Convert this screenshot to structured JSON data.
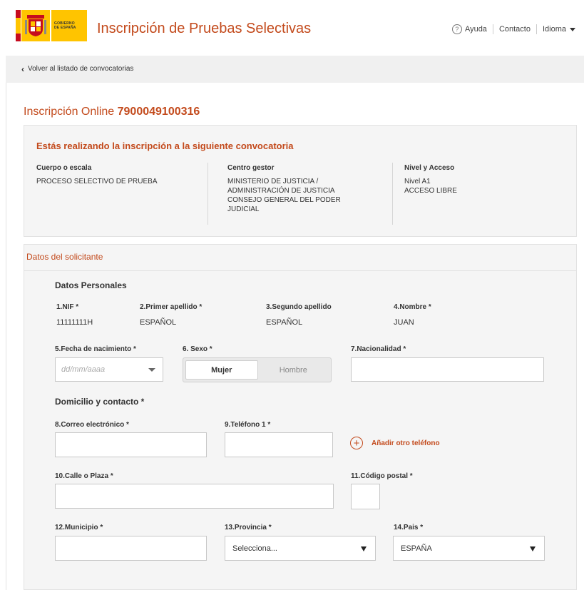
{
  "header": {
    "gov_line1": "GOBIERNO",
    "gov_line2": "DE ESPAÑA",
    "title": "Inscripción de Pruebas Selectivas",
    "help_label": "Ayuda",
    "contact_label": "Contacto",
    "language_label": "Idioma"
  },
  "breadcrumb": {
    "back_label": "Volver al listado de convocatorias"
  },
  "page": {
    "title_prefix": "Inscripción Online",
    "registration_number": "7900049100316"
  },
  "convocatoria": {
    "heading": "Estás realizando la inscripción a la siguiente convocatoria",
    "cuerpo_label": "Cuerpo o escala",
    "cuerpo_value": "PROCESO SELECTIVO DE PRUEBA",
    "centro_label": "Centro gestor",
    "centro_lines": [
      "MINISTERIO DE JUSTICIA /",
      "ADMINISTRACIÓN DE JUSTICIA",
      "CONSEJO GENERAL DEL PODER",
      "JUDICIAL"
    ],
    "nivel_label": "Nivel y Acceso",
    "nivel_lines": [
      "Nivel A1",
      "ACCESO LIBRE"
    ]
  },
  "solicitante": {
    "title": "Datos del solicitante",
    "personal_section": "Datos Personales",
    "nif_label": "1.NIF *",
    "nif_value": "11111111H",
    "apellido1_label": "2.Primer apellido *",
    "apellido1_value": "ESPAÑOL",
    "apellido2_label": "3.Segundo apellido",
    "apellido2_value": "ESPAÑOL",
    "nombre_label": "4.Nombre *",
    "nombre_value": "JUAN",
    "fecha_label": "5.Fecha de nacimiento *",
    "fecha_placeholder": "dd/mm/aaaa",
    "sexo_label": "6. Sexo *",
    "sexo_options": [
      "Mujer",
      "Hombre"
    ],
    "sexo_selected": "Mujer",
    "nacionalidad_label": "7.Nacionalidad *",
    "nacionalidad_value": "",
    "domicilio_section": "Domicilio y contacto *",
    "correo_label": "8.Correo electrónico *",
    "correo_value": "",
    "telefono_label": "9.Teléfono 1 *",
    "telefono_value": "",
    "add_phone_label": "Añadir otro teléfono",
    "calle_label": "10.Calle o Plaza *",
    "calle_value": "",
    "cp_label": "11.Código postal *",
    "cp_value": "",
    "municipio_label": "12.Municipio *",
    "municipio_value": "",
    "provincia_label": "13.Provincia *",
    "provincia_selected": "Selecciona...",
    "pais_label": "14.Pais *",
    "pais_selected": "ESPAÑA"
  },
  "colors": {
    "accent": "#c34a1c",
    "panel_bg": "#f5f5f5",
    "crumb_bg": "#f0f0f0"
  }
}
